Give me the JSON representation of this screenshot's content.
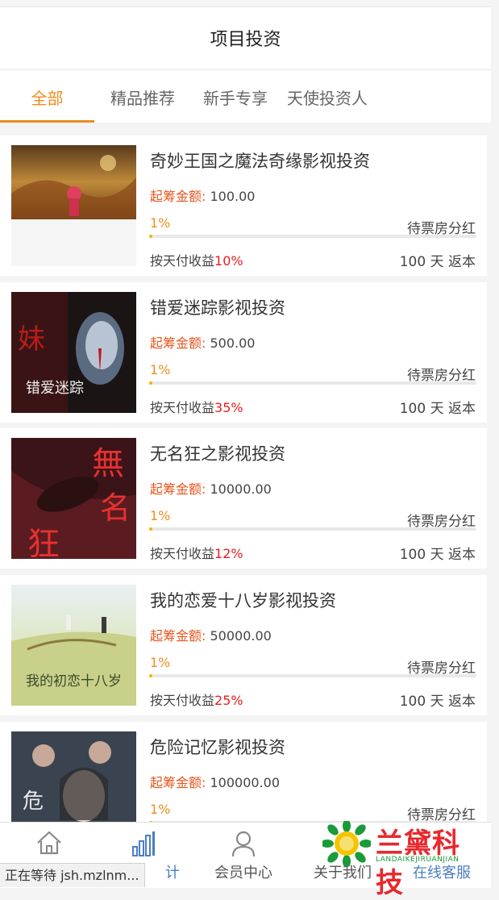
{
  "header": {
    "title": "项目投资"
  },
  "tabs": [
    {
      "label": "全部",
      "active": true
    },
    {
      "label": "精品推荐",
      "active": false
    },
    {
      "label": "新手专享",
      "active": false
    },
    {
      "label": "天使投资人",
      "active": false
    }
  ],
  "labels": {
    "start_amount": "起筹金额:",
    "daily_prefix": "按天付收益",
    "mode": "待票房分红"
  },
  "projects": [
    {
      "name": "奇妙王国之魔法奇缘影视投资",
      "amount": "100.00",
      "percent": "1%",
      "progress": 0.01,
      "rate": "10%",
      "term": "100 天 返本"
    },
    {
      "name": "错爱迷踪影视投资",
      "amount": "500.00",
      "percent": "1%",
      "progress": 0.01,
      "rate": "35%",
      "term": "100 天 返本"
    },
    {
      "name": "无名狂之影视投资",
      "amount": "10000.00",
      "percent": "1%",
      "progress": 0.01,
      "rate": "12%",
      "term": "100 天 返本"
    },
    {
      "name": "我的恋爱十八岁影视投资",
      "amount": "50000.00",
      "percent": "1%",
      "progress": 0.01,
      "rate": "25%",
      "term": "100 天 返本"
    },
    {
      "name": "危险记忆影视投资",
      "amount": "100000.00",
      "percent": "1%",
      "progress": 0.01,
      "rate": "",
      "term": ""
    }
  ],
  "bottom_nav": [
    {
      "label": "",
      "icon": "home-icon"
    },
    {
      "label": "计",
      "icon": "bar-chart-icon",
      "active": true
    },
    {
      "label": "会员中心",
      "icon": "user-icon"
    },
    {
      "label": "关于我们",
      "icon": "info-icon"
    },
    {
      "label": "在线客服",
      "icon": "chat-icon"
    }
  ],
  "status_bar": {
    "text": "正在等待 jsh.mzlnm..."
  },
  "watermark": {
    "brand": "兰黛科技",
    "brand_en": "LANDAIKEJIRUANJIAN"
  },
  "colors": {
    "accent": "#f08c1c",
    "amount_label": "#e8551c",
    "rate": "#e81c1c",
    "progress": "#f5b400",
    "nav_active": "#4a7fc1"
  }
}
